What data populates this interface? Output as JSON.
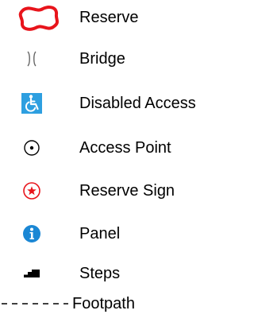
{
  "legend": {
    "items": [
      {
        "label": "Reserve",
        "icon": "reserve-boundary-icon",
        "color": "#e8141b"
      },
      {
        "label": "Bridge",
        "icon": "bridge-icon",
        "color": "#666666"
      },
      {
        "label": "Disabled Access",
        "icon": "wheelchair-icon",
        "color": "#2d9fe0"
      },
      {
        "label": "Access Point",
        "icon": "access-point-icon",
        "color": "#000000"
      },
      {
        "label": "Reserve Sign",
        "icon": "reserve-sign-star-icon",
        "color": "#e8141b"
      },
      {
        "label": "Panel",
        "icon": "info-panel-icon",
        "color": "#1b87d4"
      },
      {
        "label": "Steps",
        "icon": "steps-icon",
        "color": "#000000"
      },
      {
        "label": "Footpath",
        "icon": "footpath-dashed-line-icon",
        "color": "#000000"
      }
    ]
  }
}
